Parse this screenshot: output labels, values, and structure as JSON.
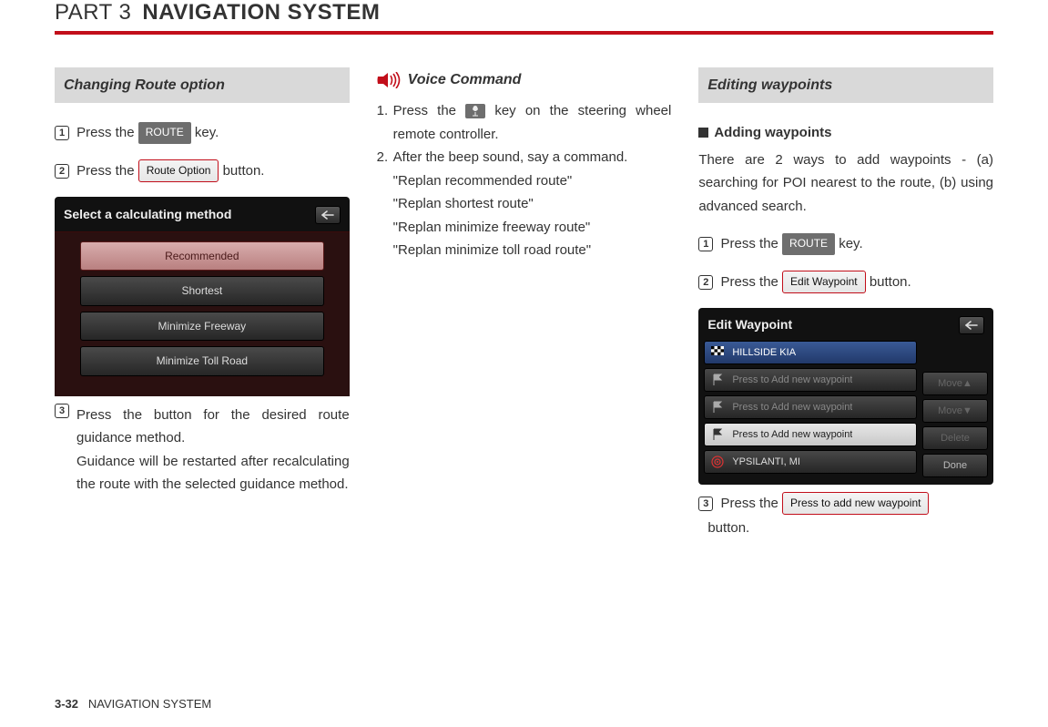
{
  "header": {
    "part_label": "PART 3",
    "part_title": "NAVIGATION SYSTEM"
  },
  "col1": {
    "section": "Changing Route option",
    "step1_a": "Press the ",
    "step1_btn": "ROUTE",
    "step1_b": " key.",
    "step2_a": "Press the ",
    "step2_btn": "Route Option",
    "step2_b": " button.",
    "screen_title": "Select a calculating method",
    "options": [
      "Recommended",
      "Shortest",
      "Minimize Freeway",
      "Minimize Toll Road"
    ],
    "step3_line1": "Press the button for the desired route guidance method.",
    "step3_line2": "Guidance will be restarted after recalculating the route with the selected guidance method."
  },
  "col2": {
    "title": "Voice Command",
    "s1_a": "Press the ",
    "s1_b": " key on the steering wheel remote controller.",
    "s2": "After the beep sound, say a command.",
    "cmds": [
      "\"Replan recommended route\"",
      "\"Replan shortest route\"",
      "\"Replan minimize freeway route\"",
      "\"Replan minimize toll road route\""
    ]
  },
  "col3": {
    "section": "Editing waypoints",
    "sub": "Adding waypoints",
    "intro": "There are 2 ways to add waypoints - (a) searching for POI nearest to the route, (b) using advanced search.",
    "step1_a": "Press the ",
    "step1_btn": "ROUTE",
    "step1_b": " key.",
    "step2_a": "Press the ",
    "step2_btn": "Edit Waypoint",
    "step2_b": " button.",
    "screen_title": "Edit Waypoint",
    "rows": [
      {
        "label": "HILLSIDE KIA"
      },
      {
        "label": "Press to Add new waypoint"
      },
      {
        "label": "Press to Add new waypoint"
      },
      {
        "label": "Press to Add new waypoint"
      },
      {
        "label": "YPSILANTI, MI"
      }
    ],
    "sidebtns": [
      "Move▲",
      "Move▼",
      "Delete",
      "Done"
    ],
    "step3_a": "Press the ",
    "step3_btn": "Press to add new waypoint",
    "step3_b": "button."
  },
  "footer": {
    "page": "3-32",
    "label": "NAVIGATION SYSTEM"
  }
}
